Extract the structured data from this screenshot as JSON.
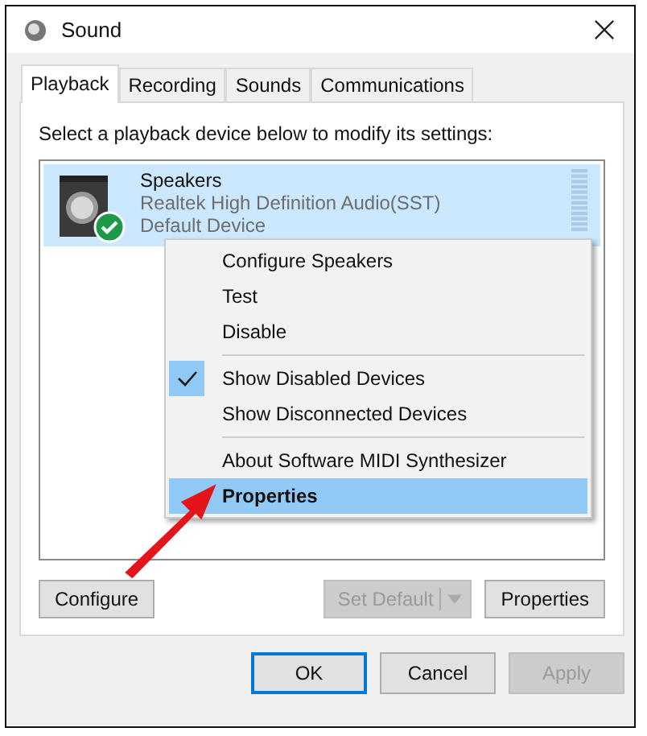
{
  "window": {
    "title": "Sound"
  },
  "tabs": [
    {
      "label": "Playback",
      "selected": true
    },
    {
      "label": "Recording",
      "selected": false
    },
    {
      "label": "Sounds",
      "selected": false
    },
    {
      "label": "Communications",
      "selected": false
    }
  ],
  "instruction": "Select a playback device below to modify its settings:",
  "devices": [
    {
      "name": "Speakers",
      "description": "Realtek High Definition Audio(SST)",
      "status": "Default Device",
      "selected": true,
      "is_default": true
    }
  ],
  "context_menu": [
    {
      "kind": "item",
      "label": "Configure Speakers",
      "checked": false,
      "selected": false
    },
    {
      "kind": "item",
      "label": "Test",
      "checked": false,
      "selected": false
    },
    {
      "kind": "item",
      "label": "Disable",
      "checked": false,
      "selected": false
    },
    {
      "kind": "separator"
    },
    {
      "kind": "item",
      "label": "Show Disabled Devices",
      "checked": true,
      "selected": false
    },
    {
      "kind": "item",
      "label": "Show Disconnected Devices",
      "checked": false,
      "selected": false
    },
    {
      "kind": "separator"
    },
    {
      "kind": "item",
      "label": "About Software MIDI Synthesizer",
      "checked": false,
      "selected": false
    },
    {
      "kind": "item",
      "label": "Properties",
      "checked": false,
      "selected": true
    }
  ],
  "panel_buttons": [
    {
      "kind": "button",
      "label": "Configure",
      "disabled": false
    },
    {
      "kind": "split",
      "label": "Set Default",
      "disabled": true
    },
    {
      "kind": "button",
      "label": "Properties",
      "disabled": false
    }
  ],
  "dialog_buttons": [
    {
      "label": "OK",
      "disabled": false,
      "focused": true
    },
    {
      "label": "Cancel",
      "disabled": false,
      "focused": false
    },
    {
      "label": "Apply",
      "disabled": true,
      "focused": false
    }
  ]
}
